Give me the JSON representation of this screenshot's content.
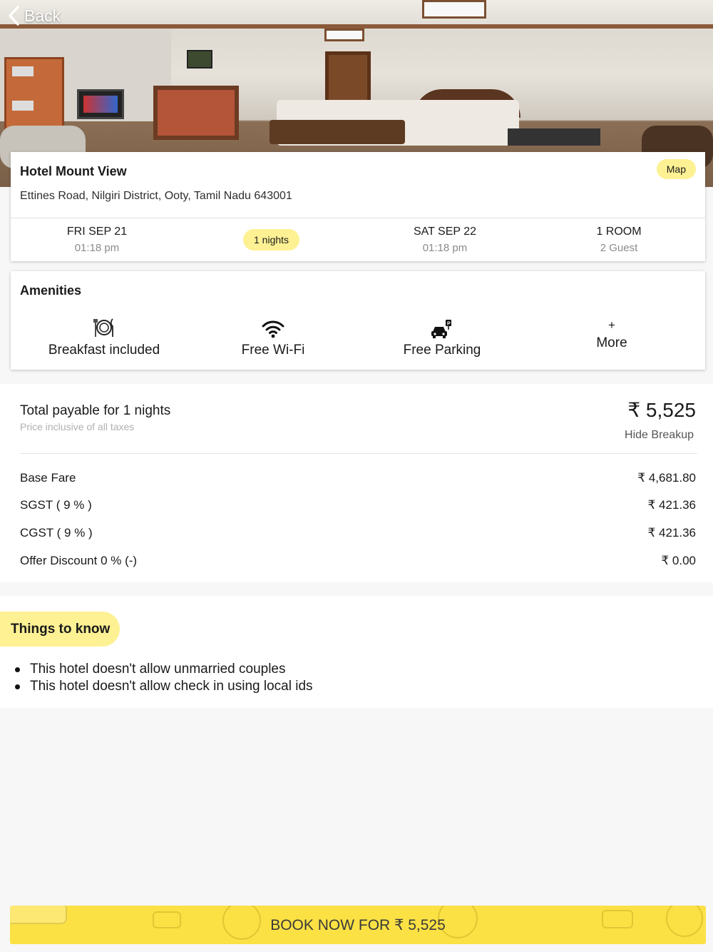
{
  "nav": {
    "back_label": "Back"
  },
  "hotel": {
    "name": "Hotel Mount View",
    "address": "Ettines Road, Nilgiri District, Ooty, Tamil Nadu 643001",
    "map_label": "Map"
  },
  "stay": {
    "checkin_date": "FRI SEP 21",
    "checkin_time": "01:18 pm",
    "nights_label": "1 nights",
    "checkout_date": "SAT SEP 22",
    "checkout_time": "01:18 pm",
    "rooms": "1 ROOM",
    "guests": "2 Guest"
  },
  "amenities": {
    "title": "Amenities",
    "items": [
      {
        "label": "Breakfast included",
        "icon": "plate-icon"
      },
      {
        "label": "Free Wi-Fi",
        "icon": "wifi-icon"
      },
      {
        "label": "Free Parking",
        "icon": "parking-car-icon"
      }
    ],
    "more_plus": "+",
    "more_label": "More"
  },
  "price": {
    "total_label": "Total payable for 1 nights",
    "total_sub": "Price inclusive of all taxes",
    "total_amount": "₹ 5,525",
    "hide_breakup": "Hide Breakup",
    "rows": [
      {
        "label": "Base Fare",
        "value": "₹ 4,681.80"
      },
      {
        "label": "SGST ( 9 % )",
        "value": "₹ 421.36"
      },
      {
        "label": "CGST ( 9 % )",
        "value": "₹ 421.36"
      },
      {
        "label": "Offer Discount 0 % (-)",
        "value": "₹ 0.00"
      }
    ]
  },
  "things": {
    "title": "Things to know",
    "items": [
      "This hotel doesn't allow unmarried couples",
      "This hotel doesn't allow check in using local ids"
    ]
  },
  "book": {
    "label": "BOOK NOW FOR ₹ 5,525"
  },
  "colors": {
    "accent_yellow": "#fdf193",
    "book_yellow": "#fbe144"
  }
}
